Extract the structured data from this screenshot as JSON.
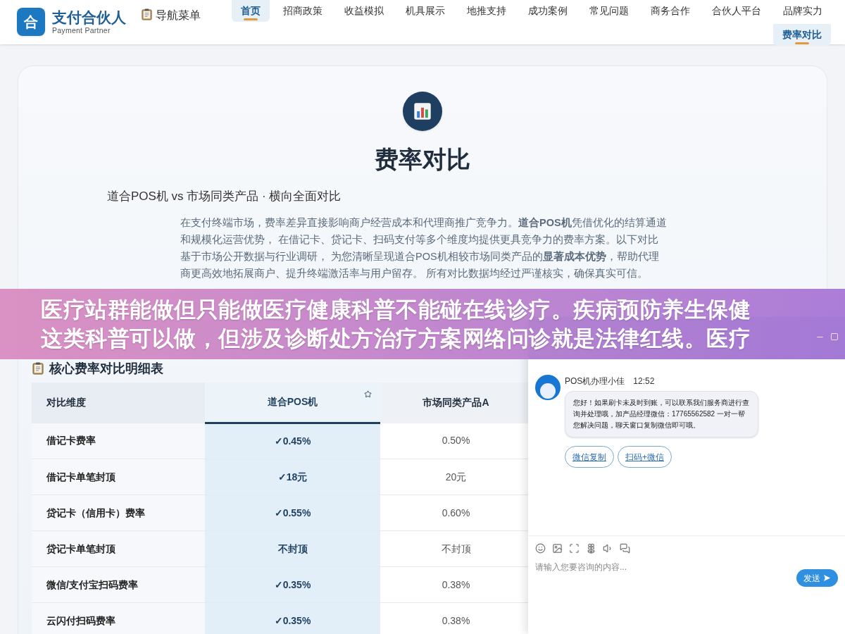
{
  "brand": {
    "logo": "合",
    "name": "支付合伙人",
    "tagline": "Payment Partner"
  },
  "menu_label": "导航菜单",
  "nav": [
    {
      "label": "首页",
      "selected": true
    },
    {
      "label": "招商政策",
      "selected": false
    },
    {
      "label": "收益模拟",
      "selected": false
    },
    {
      "label": "机具展示",
      "selected": false
    },
    {
      "label": "地推支持",
      "selected": false
    },
    {
      "label": "成功案例",
      "selected": false
    },
    {
      "label": "常见问题",
      "selected": false
    },
    {
      "label": "商务合作",
      "selected": false
    },
    {
      "label": "合伙人平台",
      "selected": false
    },
    {
      "label": "品牌实力",
      "selected": false
    },
    {
      "label": "费率对比",
      "selected": true
    }
  ],
  "section": {
    "title": "费率对比",
    "subtitle": "道合POS机 vs 市场同类产品 · 横向全面对比",
    "intro": "在支付终端市场，费率差异直接影响商户经营成本和代理商推广竞争力。**道合POS机**凭借优化的结算通道和规模化运营优势， 在借记卡、贷记卡、扫码支付等多个维度均提供更具竞争力的费率方案。以下对比基于市场公开数据与行业调研， 为您清晰呈现道合POS机相较市场同类产品的**显著成本优势**，帮助代理商更高效地拓展商户、提升终端激活率与用户留存。 所有对比数据均经过严谨核实，确保真实可信。"
  },
  "table": {
    "title": "核心费率对比明细表",
    "columns": [
      {
        "label": "对比维度",
        "featured": false
      },
      {
        "label": "道合POS机",
        "featured": true
      },
      {
        "label": "市场同类产品A",
        "featured": false
      }
    ],
    "rows": [
      [
        "借记卡费率",
        "✓0.45%",
        "0.50%"
      ],
      [
        "借记卡单笔封顶",
        "✓18元",
        "20元"
      ],
      [
        "贷记卡（信用卡）费率",
        "✓0.55%",
        "0.60%"
      ],
      [
        "贷记卡单笔封顶",
        "不封顶",
        "不封顶"
      ],
      [
        "微信/支付宝扫码费率",
        "✓0.35%",
        "0.38%"
      ],
      [
        "云闪付扫码费率",
        "✓0.35%",
        "0.38%"
      ]
    ]
  },
  "overlay_banner": {
    "lines": [
      "医疗站群能做但只能做医疗健康科普不能碰在线诊疗。疾病预防养生保健",
      "这类科普可以做，但涉及诊断处方治疗方案网络问诊就是法律红线。医疗"
    ]
  },
  "chat": {
    "agent": "POS机办理小佳",
    "time": "12:52",
    "message": "您好！如果刷卡未及时到账，可以联系我们服务商进行查询并处理哦，加产品经理微信：17765562582 一对一帮您解决问题，聊天窗口复制微信即可哦。",
    "quick_replies": [
      "微信复制",
      "扫码+微信"
    ],
    "input_placeholder": "请输入您要咨询的内容...",
    "send": "发送"
  }
}
